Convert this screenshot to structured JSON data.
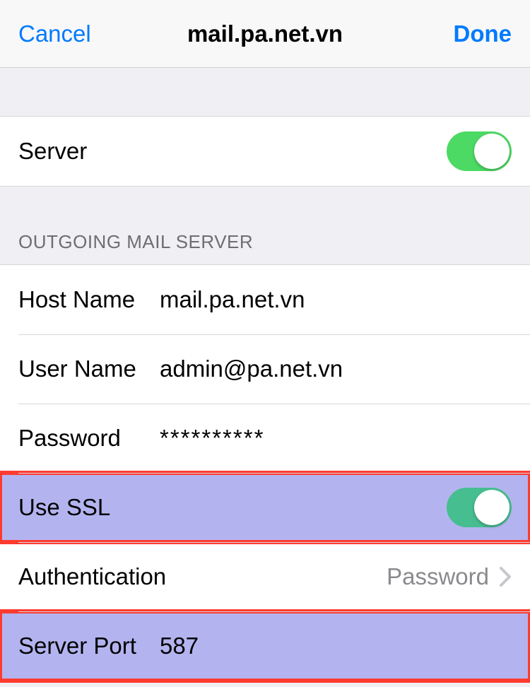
{
  "nav": {
    "cancel": "Cancel",
    "title": "mail.pa.net.vn",
    "done": "Done"
  },
  "server_toggle": {
    "label": "Server",
    "on": true
  },
  "section_header": "OUTGOING MAIL SERVER",
  "rows": {
    "host_name_label": "Host Name",
    "host_name_value": "mail.pa.net.vn",
    "user_name_label": "User Name",
    "user_name_value": "admin@pa.net.vn",
    "password_label": "Password",
    "password_value": "**********",
    "use_ssl_label": "Use SSL",
    "use_ssl_on": true,
    "authentication_label": "Authentication",
    "authentication_value": "Password",
    "server_port_label": "Server Port",
    "server_port_value": "587"
  }
}
